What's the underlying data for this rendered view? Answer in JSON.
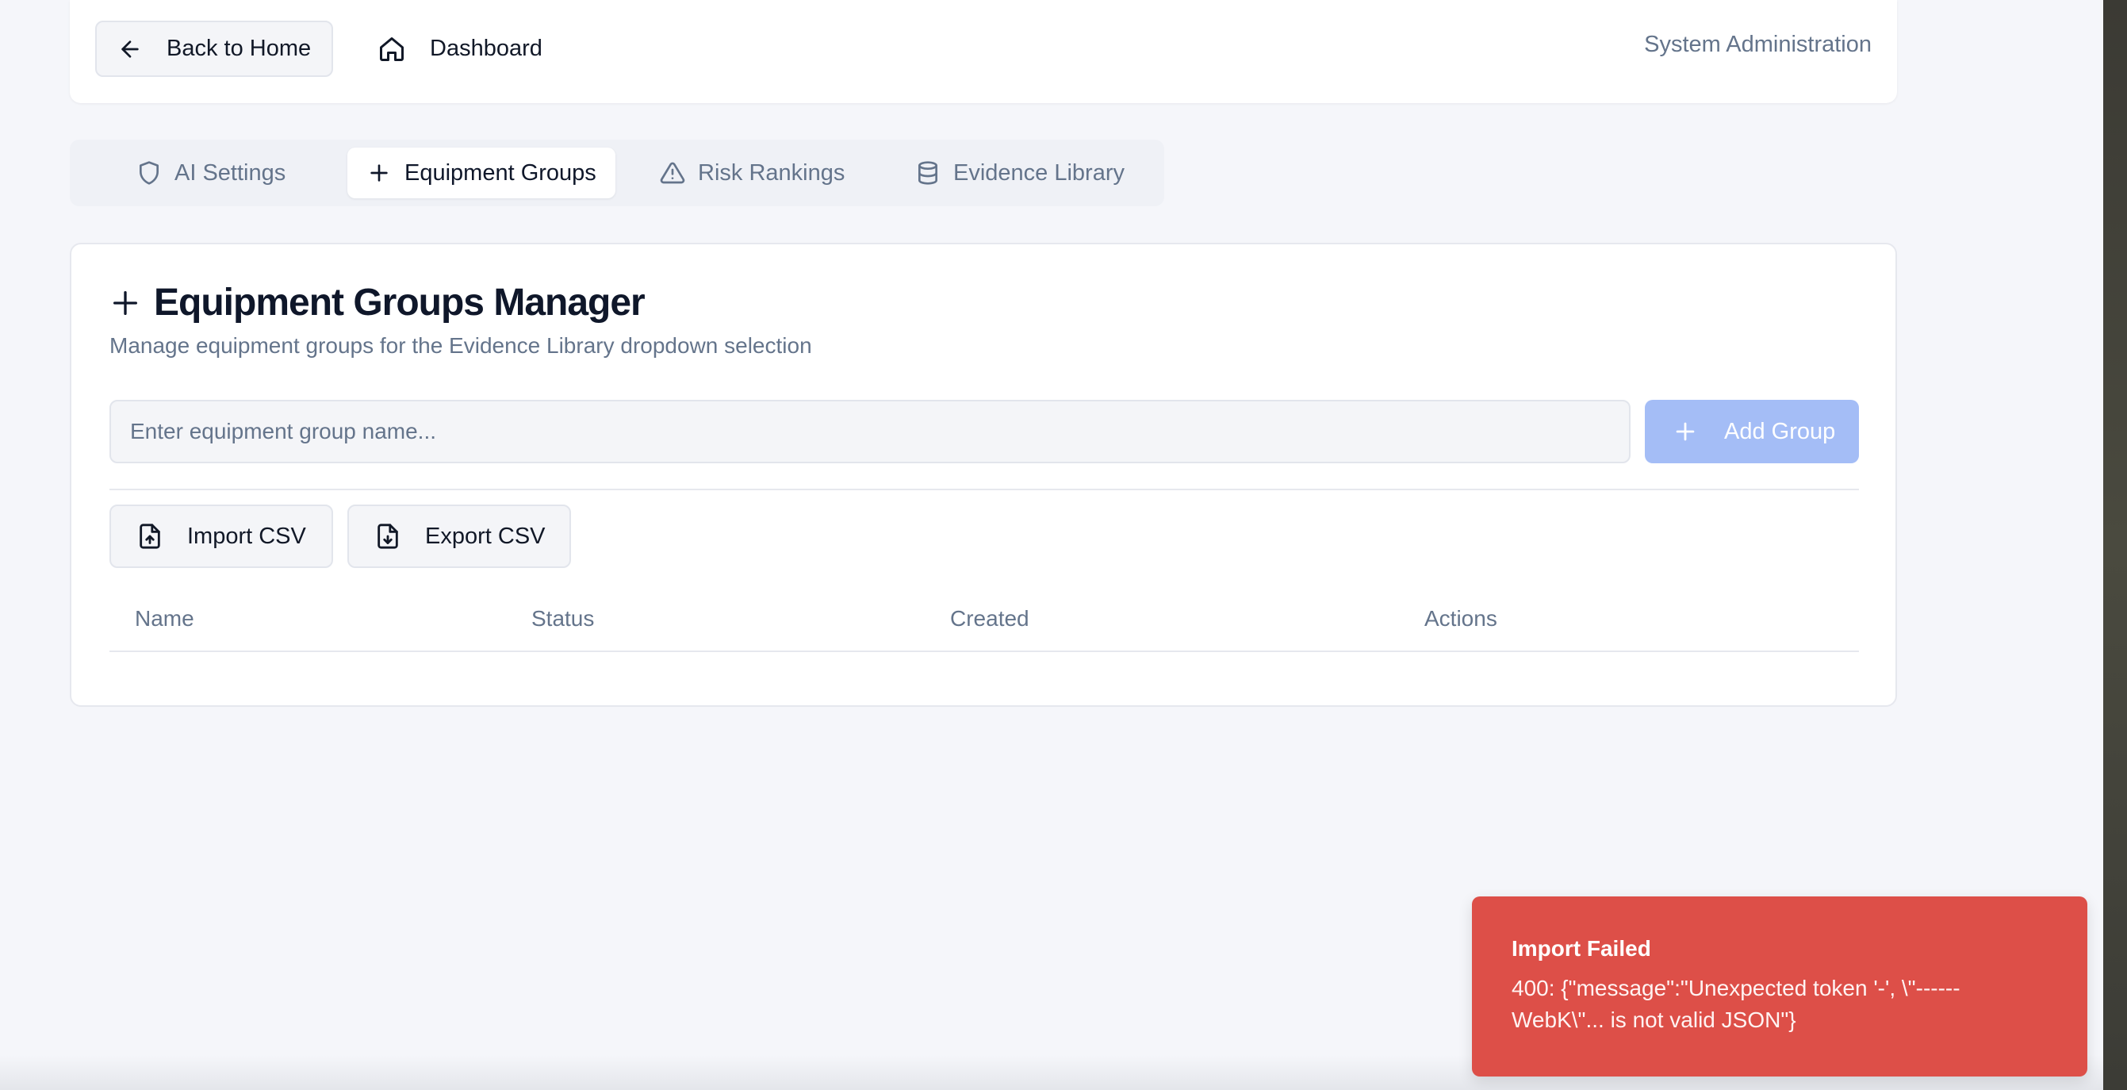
{
  "header": {
    "back_label": "Back to Home",
    "dashboard_label": "Dashboard",
    "section_label": "System Administration"
  },
  "tabs": [
    {
      "label": "AI Settings",
      "icon": "shield-icon",
      "active": false
    },
    {
      "label": "Equipment Groups",
      "icon": "plus-icon",
      "active": true
    },
    {
      "label": "Risk Rankings",
      "icon": "warning-triangle-icon",
      "active": false
    },
    {
      "label": "Evidence Library",
      "icon": "database-icon",
      "active": false
    }
  ],
  "card": {
    "title": "Equipment Groups Manager",
    "subtitle": "Manage equipment groups for the Evidence Library dropdown selection",
    "input_placeholder": "Enter equipment group name...",
    "input_value": "",
    "add_label": "Add Group",
    "import_label": "Import CSV",
    "export_label": "Export CSV",
    "columns": [
      "Name",
      "Status",
      "Created",
      "Actions"
    ]
  },
  "toast": {
    "title": "Import Failed",
    "message": "400: {\"message\":\"Unexpected token '-', \\\"------WebK\\\"... is not valid JSON\"}"
  },
  "colors": {
    "background": "#f5f6fa",
    "add_button": "#a4bdf6",
    "toast": "#dd4f48",
    "muted_text": "#64748b"
  }
}
